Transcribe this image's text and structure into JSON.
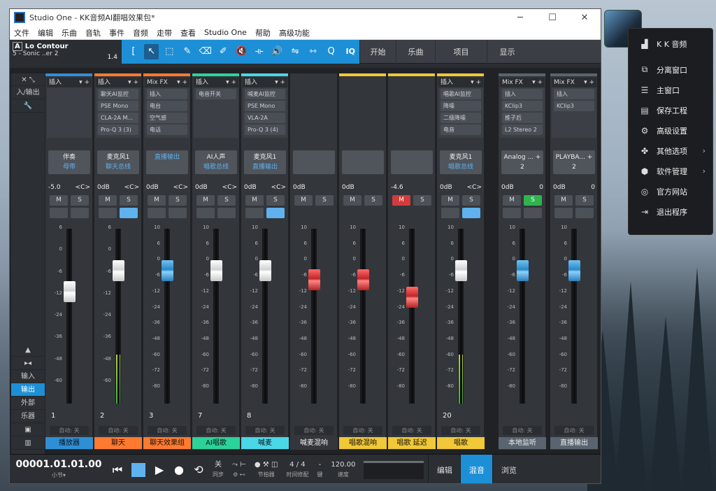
{
  "window": {
    "title": "Studio One - KK音频AI翻唱效果包*",
    "min": "─",
    "max": "☐",
    "close": "✕"
  },
  "menu": [
    "文件",
    "编辑",
    "乐曲",
    "音轨",
    "事件",
    "音频",
    "走带",
    "查看",
    "Studio One",
    "帮助",
    "高级功能"
  ],
  "song": {
    "mode": "A",
    "name": "Lo Contour",
    "track": "5 - Sonic ..er 2",
    "ver": "1.4"
  },
  "tools": [
    "[",
    "↖",
    "⬚",
    "✎",
    "⌫",
    "✐",
    "🔇",
    "⟛",
    "🔊",
    "⇋",
    "⇿",
    "Q",
    "IQ"
  ],
  "toolbar_buttons": [
    "开始",
    "乐曲",
    "项目",
    "显示"
  ],
  "left_panel": {
    "io_label": "入/输出",
    "items": [
      "输入",
      "输出",
      "外部",
      "乐器"
    ]
  },
  "channels": [
    {
      "num": "1",
      "name": "播放器",
      "color": "#2f8fd6",
      "io_top": "伴奏",
      "io_bot": "母带",
      "vol": "-5.0",
      "pan": "<C>",
      "inserts_header": "插入",
      "inserts": []
    },
    {
      "num": "2",
      "name": "聊天",
      "color": "#ff7a2f",
      "io_top": "麦克风1",
      "io_bot": "聊天总线",
      "vol": "0dB",
      "pan": "<C>",
      "inserts_header": "插入",
      "inserts": [
        "聊天AI监控",
        "PSE Mono",
        "CLA-2A M...",
        "Pro-Q 3 (3)"
      ]
    },
    {
      "num": "3",
      "name": "聊天效果组",
      "color": "#ff7a2f",
      "io_top": "",
      "io_bot": "直播输出",
      "vol": "0dB",
      "pan": "<C>",
      "inserts_header": "Mix FX",
      "inserts": [
        "插入",
        "电台",
        "空气感",
        "电话"
      ]
    },
    {
      "num": "7",
      "name": "AI唱歌",
      "color": "#2bd39a",
      "io_top": "AI人声",
      "io_bot": "唱歌总线",
      "vol": "0dB",
      "pan": "<C>",
      "inserts_header": "插入",
      "inserts": [
        "电音开关"
      ]
    },
    {
      "num": "8",
      "name": "喊麦",
      "color": "#4ad7e8",
      "io_top": "麦克风1",
      "io_bot": "直播输出",
      "vol": "0dB",
      "pan": "<C>",
      "inserts_header": "插入",
      "inserts": [
        "喊麦AI监控",
        "PSE Mono",
        "VLA-2A",
        "Pro-Q 3 (4)"
      ]
    },
    {
      "num": "",
      "name": "喊麦混响",
      "color": "#33363b",
      "io_top": "",
      "io_bot": "",
      "vol": "0dB",
      "pan": "",
      "inserts_header": "",
      "inserts": []
    },
    {
      "num": "",
      "name": "唱歌混响",
      "color": "#f0c838",
      "io_top": "",
      "io_bot": "",
      "vol": "0dB",
      "pan": "",
      "inserts_header": "",
      "inserts": []
    },
    {
      "num": "",
      "name": "唱歌 延迟",
      "color": "#f0c838",
      "io_top": "",
      "io_bot": "",
      "vol": "-4.6",
      "pan": "",
      "inserts_header": "",
      "inserts": []
    },
    {
      "num": "20",
      "name": "唱歌",
      "color": "#f0c838",
      "io_top": "麦克风1",
      "io_bot": "唱歌总线",
      "vol": "0dB",
      "pan": "<C>",
      "inserts_header": "插入",
      "inserts": [
        "唱歌AI监控",
        "降噪",
        "二级降噪",
        "电音"
      ]
    },
    {
      "num": "",
      "name": "本地监听",
      "color": "#5a6470",
      "io_top": "Analog ... + 2",
      "io_bot": "",
      "vol": "0dB",
      "pan": "0",
      "inserts_header": "Mix FX",
      "inserts": [
        "插入",
        "KClip3",
        "推子后",
        "L2 Stereo 2"
      ]
    },
    {
      "num": "",
      "name": "直播输出",
      "color": "#5a6470",
      "io_top": "PLAYBA... + 2",
      "io_bot": "",
      "vol": "0dB",
      "pan": "0",
      "inserts_header": "Mix FX",
      "inserts": [
        "插入",
        "KClip3"
      ]
    }
  ],
  "common": {
    "mute": "M",
    "solo": "S",
    "auto": "自动: 关"
  },
  "fader_scale": [
    "6",
    "0",
    "-6",
    "-12",
    "-24",
    "-36",
    "-48",
    "-60"
  ],
  "fader_scale_b": [
    "10",
    "6",
    "0",
    "-6",
    "-12",
    "-24",
    "-36",
    "-48",
    "-60",
    "-72",
    "-80"
  ],
  "fader_pos": [
    0.3,
    0.18,
    0.18,
    0.18,
    0.18,
    0.23,
    0.23,
    0.33,
    0.18,
    0.18,
    0.18
  ],
  "meter_level": [
    0,
    0.28,
    0,
    0,
    0,
    0,
    0,
    0,
    0.28,
    0,
    0
  ],
  "transport": {
    "time": "00001.01.01.00",
    "unit": "小节▾",
    "sync_top": "关",
    "sync": "同步",
    "metro": "节拍器",
    "sig": "4 / 4",
    "sig_label": "时间修配",
    "key": "-",
    "key_label": "键",
    "tempo": "120.00",
    "tempo_label": "速度"
  },
  "nav": [
    "编辑",
    "混音",
    "浏览"
  ],
  "context_menu": {
    "header": "K K 音频",
    "items": [
      {
        "icon": "⧉",
        "label": "分离窗口",
        "arrow": ""
      },
      {
        "icon": "☰",
        "label": "主窗口",
        "arrow": ""
      },
      {
        "icon": "▤",
        "label": "保存工程",
        "arrow": ""
      },
      {
        "icon": "⚙",
        "label": "高级设置",
        "arrow": ""
      },
      {
        "icon": "✤",
        "label": "其他选项",
        "arrow": "›"
      },
      {
        "icon": "⬢",
        "label": "软件管理",
        "arrow": "›"
      },
      {
        "icon": "◎",
        "label": "官方网站",
        "arrow": ""
      },
      {
        "icon": "⇥",
        "label": "退出程序",
        "arrow": ""
      }
    ]
  }
}
